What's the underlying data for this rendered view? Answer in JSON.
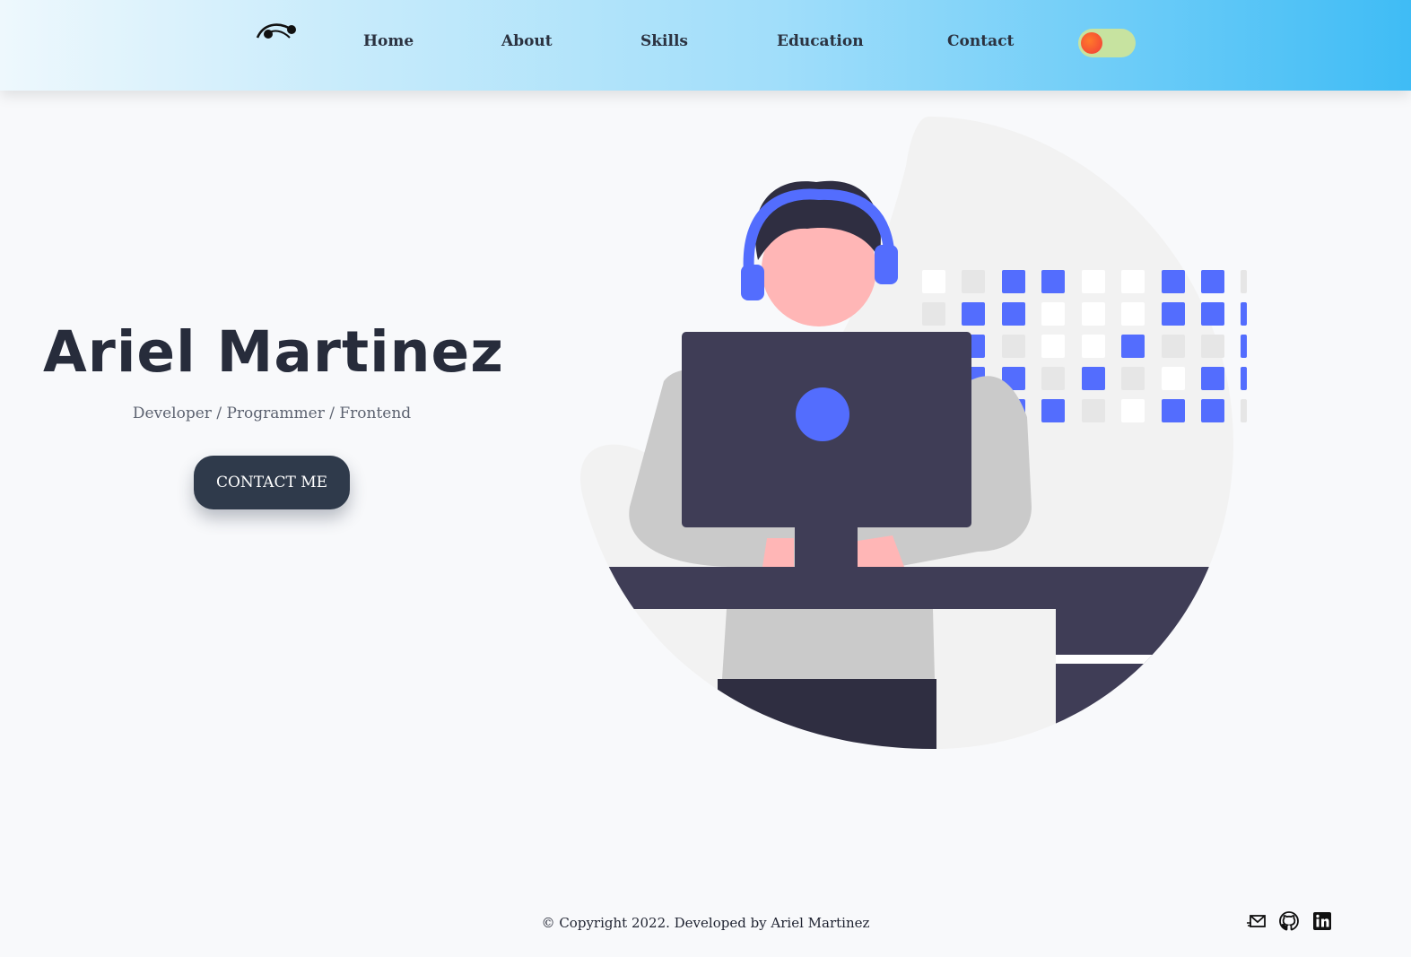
{
  "nav": {
    "logo_icon": "signature-logo-icon",
    "links": [
      {
        "label": "Home"
      },
      {
        "label": "About"
      },
      {
        "label": "Skills"
      },
      {
        "label": "Education"
      },
      {
        "label": "Contact"
      }
    ],
    "theme_toggle_icon": "theme-toggle-icon"
  },
  "hero": {
    "name": "Ariel Martinez",
    "subtitle": "Developer / Programmer / Frontend",
    "cta_label": "CONTACT ME",
    "illustration_icon": "developer-at-computer-illustration",
    "colors": {
      "accent_blue": "#536dfe",
      "dark": "#3f3d56",
      "skin": "#ffb6b6",
      "text_dark": "#272c3b"
    }
  },
  "footer": {
    "copyright": "© Copyright 2022. Developed by Ariel Martinez",
    "social_icons": [
      "mail-icon",
      "github-icon",
      "linkedin-icon"
    ]
  }
}
